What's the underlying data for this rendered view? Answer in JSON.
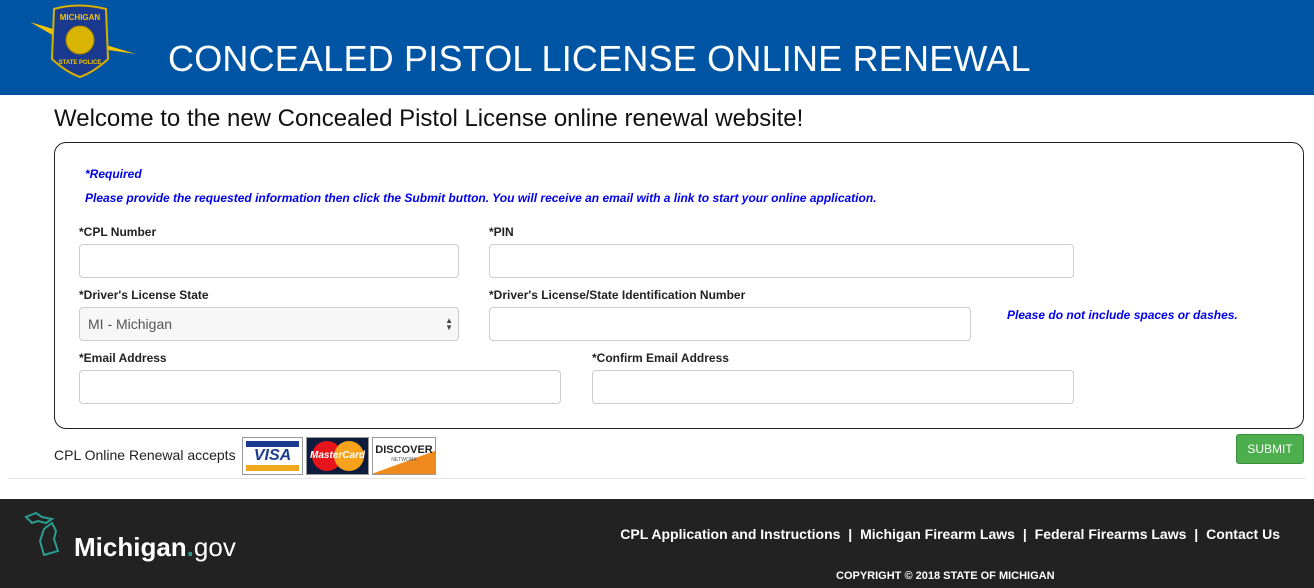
{
  "header": {
    "title": "CONCEALED PISTOL LICENSE ONLINE RENEWAL",
    "logo_text": "MICHIGAN STATE POLICE"
  },
  "welcome": "Welcome to the new Concealed Pistol License online renewal website!",
  "form": {
    "required_note": "*Required",
    "instructions": "Please provide the requested information then click the Submit button. You will receive an email with a link to start your online application.",
    "cpl_label": "*CPL Number",
    "cpl_value": "",
    "pin_label": "*PIN",
    "pin_value": "",
    "dl_state_label": "*Driver's License State",
    "dl_state_value": "MI - Michigan",
    "dl_number_label": "*Driver's License/State Identification Number",
    "dl_number_value": "",
    "dl_hint": "Please do not include spaces or dashes.",
    "email_label": "*Email Address",
    "email_value": "",
    "confirm_email_label": "*Confirm Email Address",
    "confirm_email_value": ""
  },
  "payment": {
    "accepts": "CPL Online Renewal accepts",
    "cards": [
      "VISA",
      "MasterCard",
      "DISCOVER"
    ],
    "discover_sub": "NETWORK"
  },
  "submit_label": "SUBMIT",
  "footer": {
    "logo": {
      "main": "Michigan",
      "dot": ".",
      "suffix": "gov"
    },
    "links": [
      "CPL Application and Instructions",
      "Michigan Firearm Laws",
      "Federal Firearms Laws",
      "Contact Us"
    ],
    "separator": "|",
    "copyright": "COPYRIGHT © 2018 STATE OF MICHIGAN"
  }
}
